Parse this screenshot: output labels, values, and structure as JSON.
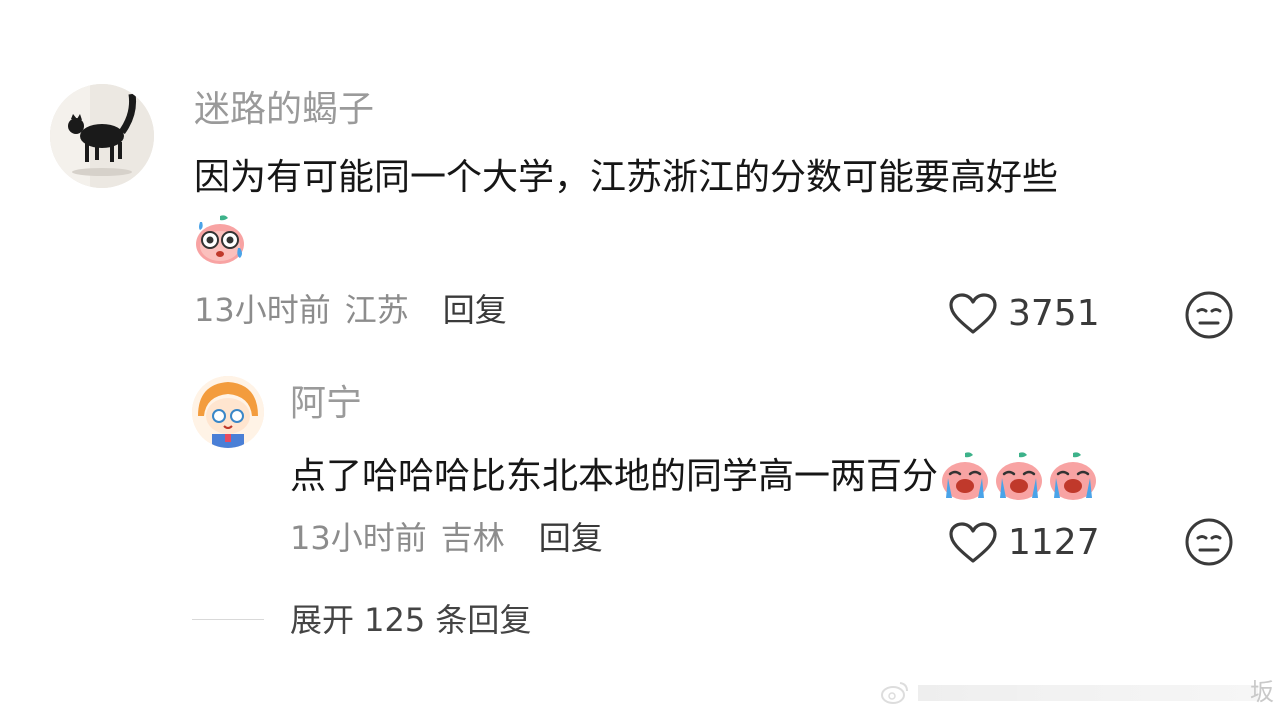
{
  "comment": {
    "username": "迷路的蝎子",
    "text": "因为有可能同一个大学，江苏浙江的分数可能要高好些",
    "emoji_icon": "sweating-peach-icon",
    "time": "13小时前",
    "location": "江苏",
    "reply_label": "回复",
    "likes": "3751"
  },
  "reply": {
    "username": "阿宁",
    "text": "点了哈哈哈比东北本地的同学高一两百分",
    "emoji_icons": [
      "crying-peach-icon",
      "crying-peach-icon",
      "crying-peach-icon"
    ],
    "time": "13小时前",
    "location": "吉林",
    "reply_label": "回复",
    "likes": "1127"
  },
  "expand_label": "展开 125 条回复",
  "watermark_text": "坂",
  "colors": {
    "username": "#9a9a9a",
    "meta": "#8c8c8c",
    "text": "#161616"
  }
}
